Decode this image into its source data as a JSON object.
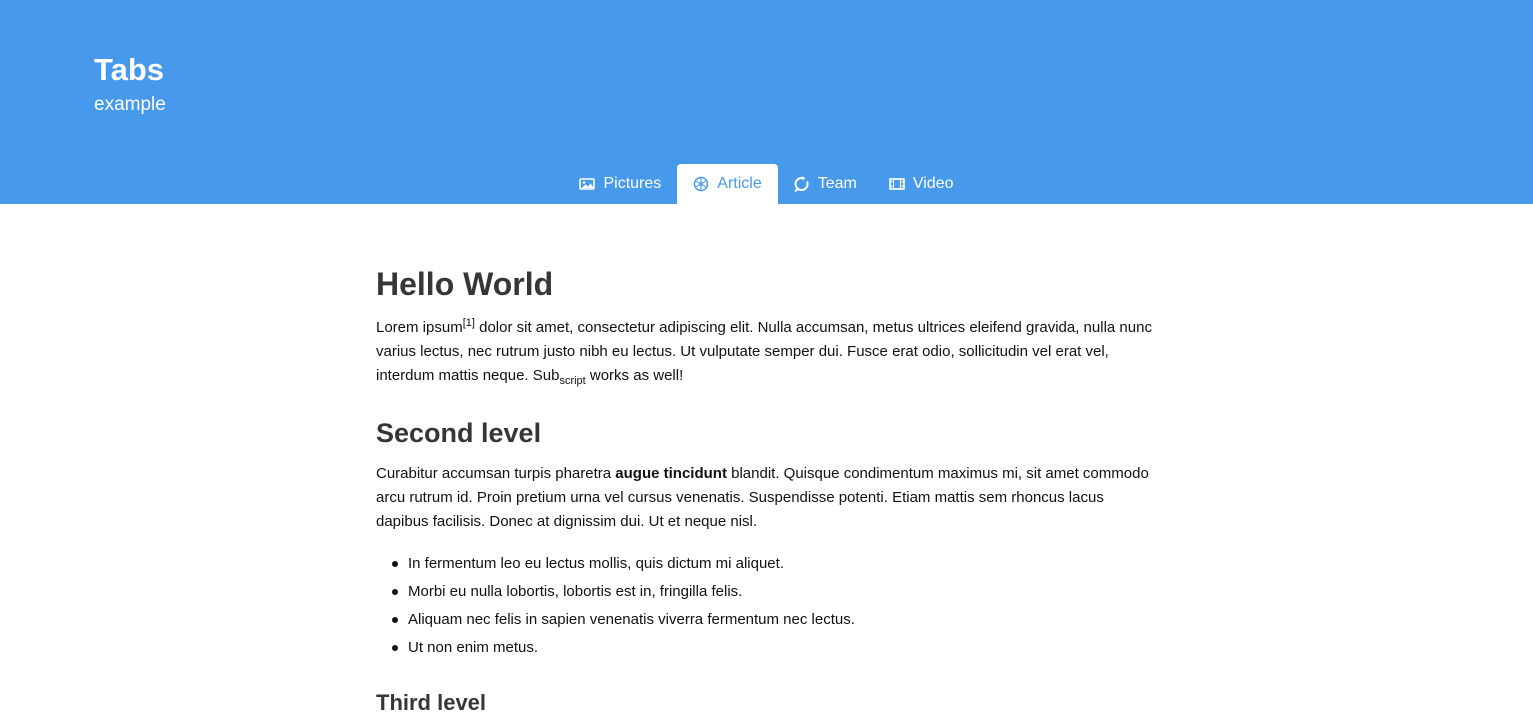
{
  "hero": {
    "title": "Tabs",
    "subtitle": "example",
    "background_color": "#4799eb"
  },
  "tabs": [
    {
      "label": "Pictures",
      "icon": "image-icon",
      "active": false
    },
    {
      "label": "Article",
      "icon": "atom-icon",
      "active": true
    },
    {
      "label": "Team",
      "icon": "circle-arrow-icon",
      "active": false
    },
    {
      "label": "Video",
      "icon": "film-icon",
      "active": false
    }
  ],
  "article": {
    "heading": "Hello World",
    "para1_a": "Lorem ipsum",
    "para1_sup": "[1]",
    "para1_b": " dolor sit amet, consectetur adipiscing elit. Nulla accumsan, metus ultrices eleifend gravida, nulla nunc varius lectus, nec rutrum justo nibh eu lectus. Ut vulputate semper dui. Fusce erat odio, sollicitudin vel erat vel, interdum mattis neque. Sub",
    "para1_sub": "script",
    "para1_c": " works as well!",
    "second_heading": "Second level",
    "para2_a": "Curabitur accumsan turpis pharetra ",
    "para2_bold": "augue tincidunt",
    "para2_b": " blandit. Quisque condimentum maximus mi, sit amet commodo arcu rutrum id. Proin pretium urna vel cursus venenatis. Suspendisse potenti. Etiam mattis sem rhoncus lacus dapibus facilisis. Donec at dignissim dui. Ut et neque nisl.",
    "bullets": [
      "In fermentum leo eu lectus mollis, quis dictum mi aliquet.",
      "Morbi eu nulla lobortis, lobortis est in, fringilla felis.",
      "Aliquam nec felis in sapien venenatis viverra fermentum nec lectus.",
      "Ut non enim metus."
    ],
    "third_heading": "Third level"
  }
}
